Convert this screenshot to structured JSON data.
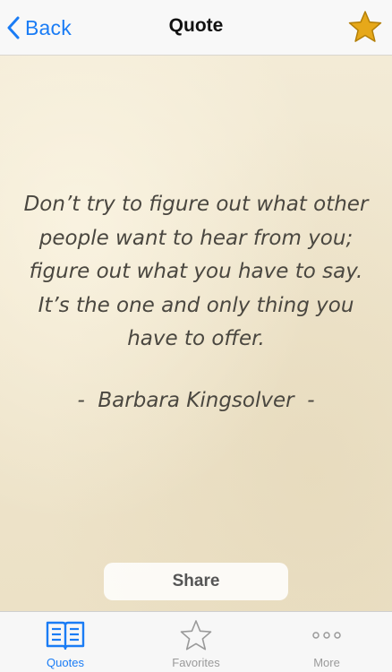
{
  "header": {
    "back_label": "Back",
    "title": "Quote",
    "favorite_star_color": "#e6a81a"
  },
  "quote": {
    "text": "Don’t try to figure out what other people want to hear from you; figure out what you have to say. It’s the one and only thing you have to offer.",
    "author": "-  Barbara Kingsolver  -"
  },
  "actions": {
    "share_label": "Share"
  },
  "tabbar": {
    "tabs": [
      {
        "label": "Quotes",
        "icon": "open-book-icon",
        "active": true
      },
      {
        "label": "Favorites",
        "icon": "star-outline-icon",
        "active": false
      },
      {
        "label": "More",
        "icon": "more-dots-icon",
        "active": false
      }
    ]
  },
  "colors": {
    "accent": "#1a7cf5",
    "inactive": "#9a9a9a",
    "text": "#4a4740"
  }
}
